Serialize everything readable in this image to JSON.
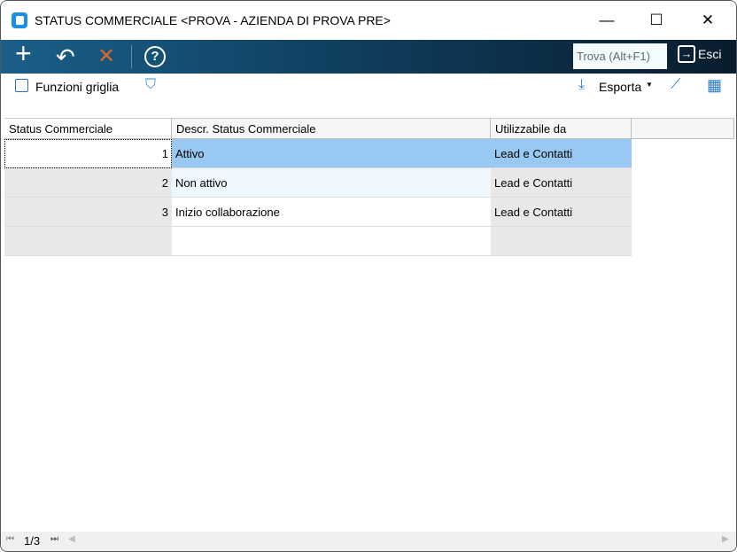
{
  "window": {
    "title": "STATUS COMMERCIALE <PROVA - AZIENDA DI PROVA PRE>",
    "minimize": "—",
    "maximize": "☐",
    "close": "✕"
  },
  "toolbar": {
    "add": "+",
    "undo": "↶",
    "delete": "✕",
    "help": "?",
    "find_placeholder": "Trova (Alt+F1)",
    "exit": "Esci"
  },
  "subtoolbar": {
    "grid_functions": "Funzioni griglia",
    "export": "Esporta"
  },
  "grid": {
    "columns": [
      "Status Commerciale",
      "Descr. Status Commerciale",
      "Utilizzabile da"
    ],
    "rows": [
      {
        "code": "1",
        "descr": "Attivo",
        "usable": "Lead e Contatti"
      },
      {
        "code": "2",
        "descr": "Non attivo",
        "usable": "Lead e Contatti"
      },
      {
        "code": "3",
        "descr": "Inizio collaborazione",
        "usable": "Lead e Contatti"
      }
    ]
  },
  "footer": {
    "page": "1/3"
  },
  "colors": {
    "selected": "#99c9f2",
    "alt_row": "#eef7fd",
    "readonly": "#e8e8e8"
  }
}
